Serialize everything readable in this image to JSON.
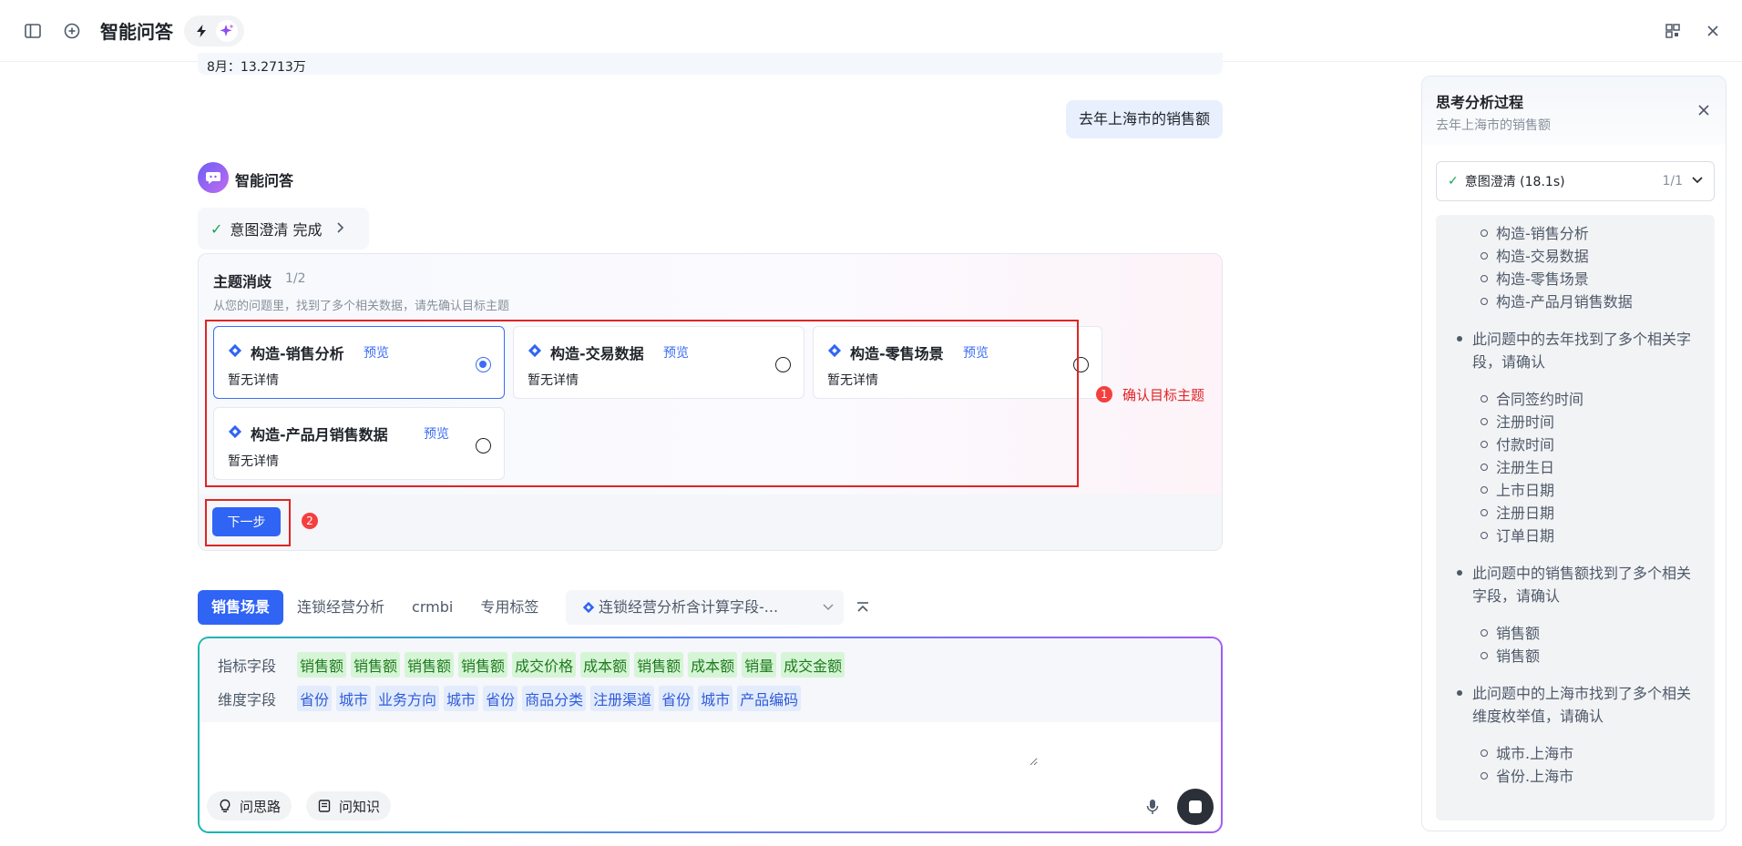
{
  "header": {
    "title": "智能问答"
  },
  "previous_message": {
    "text": "8月：13.2713万"
  },
  "user_message": {
    "text": "去年上海市的销售额"
  },
  "bot": {
    "name": "智能问答"
  },
  "status_chip": {
    "label": "意图澄清 完成"
  },
  "disambiguation": {
    "title": "主题消歧",
    "count": "1/2",
    "subtitle": "从您的问题里，找到了多个相关数据，请先确认目标主题",
    "cards": [
      {
        "name": "构造-销售分析",
        "preview": "预览",
        "desc": "暂无详情",
        "selected": true
      },
      {
        "name": "构造-交易数据",
        "preview": "预览",
        "desc": "暂无详情",
        "selected": false
      },
      {
        "name": "构造-零售场景",
        "preview": "预览",
        "desc": "暂无详情",
        "selected": false
      },
      {
        "name": "构造-产品月销售数据",
        "preview": "预览",
        "desc": "暂无详情",
        "selected": false
      }
    ],
    "annotation_1": {
      "num": "1",
      "text": "确认目标主题"
    },
    "annotation_2": {
      "num": "2"
    },
    "next_button": "下一步"
  },
  "tabs": {
    "items": [
      "销售场景",
      "连锁经营分析",
      "crmbi",
      "专用标签"
    ],
    "active_index": 0,
    "dropdown": "连锁经营分析含计算字段-..."
  },
  "input": {
    "metric_label": "指标字段",
    "metric_tags": [
      "销售额",
      "销售额",
      "销售额",
      "销售额",
      "成交价格",
      "成本额",
      "销售额",
      "成本额",
      "销量",
      "成交金额"
    ],
    "dimension_label": "维度字段",
    "dimension_tags": [
      "省份",
      "城市",
      "业务方向",
      "城市",
      "省份",
      "商品分类",
      "注册渠道",
      "省份",
      "城市",
      "产品编码"
    ],
    "value": "",
    "btn_thinking": "问思路",
    "btn_knowledge": "问知识"
  },
  "panel": {
    "title": "思考分析过程",
    "subtitle": "去年上海市的销售额",
    "step_label": "意图澄清 (18.1s)",
    "step_count": "1/1",
    "reasoning": {
      "topics": [
        "构造-销售分析",
        "构造-交易数据",
        "构造-零售场景",
        "构造-产品月销售数据"
      ],
      "point_time": "此问题中的去年找到了多个相关字段，请确认",
      "time_fields": [
        "合同签约时间",
        "注册时间",
        "付款时间",
        "注册生日",
        "上市日期",
        "注册日期",
        "订单日期"
      ],
      "point_sales": "此问题中的销售额找到了多个相关字段，请确认",
      "sales_fields": [
        "销售额",
        "销售额"
      ],
      "point_city": "此问题中的上海市找到了多个相关维度枚举值，请确认",
      "city_values": [
        "城市.上海市",
        "省份.上海市"
      ]
    }
  },
  "colors": {
    "accent": "#2f64f4",
    "success": "#1aa35a",
    "annotation": "#e02424"
  }
}
